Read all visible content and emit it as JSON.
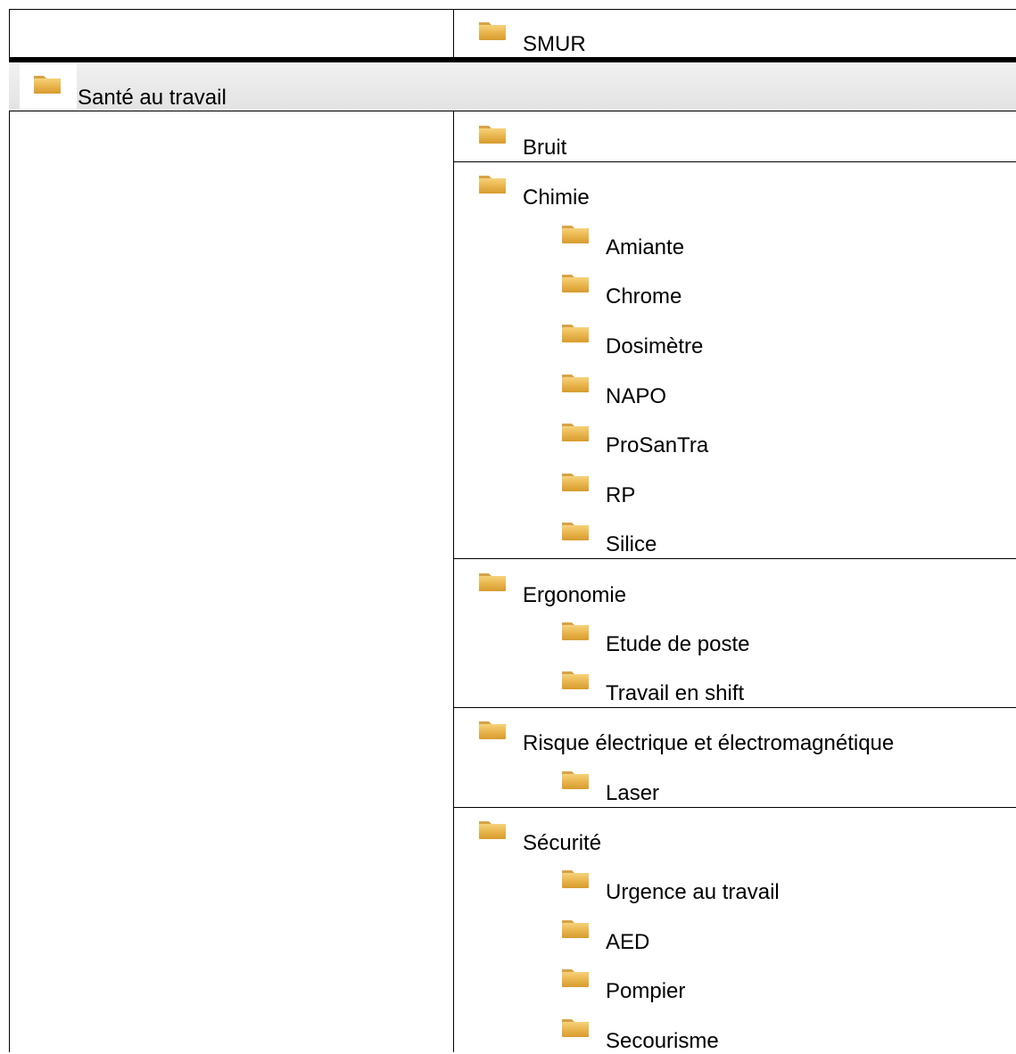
{
  "top_row": {
    "label": "SMUR",
    "icon": "folder-icon"
  },
  "section": {
    "label": "Santé au travail",
    "icon": "folder-icon"
  },
  "folders": [
    {
      "label": "Bruit",
      "icon": "folder-icon",
      "children": []
    },
    {
      "label": "Chimie",
      "icon": "folder-icon",
      "children": [
        {
          "label": "Amiante",
          "icon": "folder-icon"
        },
        {
          "label": "Chrome",
          "icon": "folder-icon"
        },
        {
          "label": "Dosimètre",
          "icon": "folder-icon"
        },
        {
          "label": "NAPO",
          "icon": "folder-icon"
        },
        {
          "label": "ProSanTra",
          "icon": "folder-icon"
        },
        {
          "label": "RP",
          "icon": "folder-icon"
        },
        {
          "label": "Silice",
          "icon": "folder-icon"
        }
      ]
    },
    {
      "label": "Ergonomie",
      "icon": "folder-icon",
      "children": [
        {
          "label": "Etude de poste",
          "icon": "folder-icon"
        },
        {
          "label": "Travail en shift",
          "icon": "folder-icon"
        }
      ]
    },
    {
      "label": "Risque électrique et électromagnétique",
      "icon": "folder-icon",
      "children": [
        {
          "label": "Laser",
          "icon": "folder-icon"
        }
      ]
    },
    {
      "label": "Sécurité",
      "icon": "folder-icon",
      "children": [
        {
          "label": "Urgence au travail",
          "icon": "folder-icon"
        },
        {
          "label": "AED",
          "icon": "folder-icon"
        },
        {
          "label": "Pompier",
          "icon": "folder-icon"
        },
        {
          "label": "Secourisme",
          "icon": "folder-icon"
        }
      ]
    }
  ]
}
